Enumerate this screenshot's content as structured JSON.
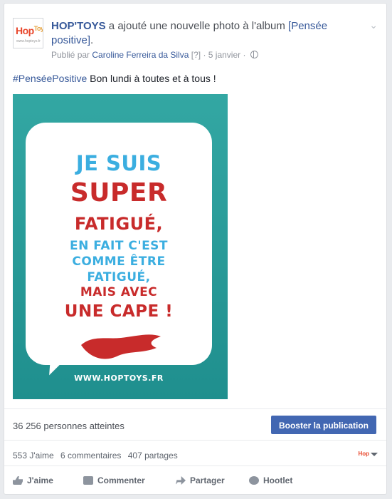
{
  "post": {
    "page_name": "HOP'TOYS",
    "action_text": " a ajouté une nouvelle photo à l'album ",
    "album_link": "[Pensée positive]",
    "after_link": ".",
    "published_by_prefix": "Publié par ",
    "author": "Caroline Ferreira da Silva",
    "qmark": "[?]",
    "date": " · 5 janvier · ",
    "hashtag": "#PenséePositive",
    "status_text": " Bon lundi à toutes et à tous !",
    "avatar_logo": "Hop",
    "avatar_logo_sup": "Toys",
    "avatar_url": "www.hoptoys.fr"
  },
  "photo": {
    "line1": "JE SUIS",
    "line2": "SUPER",
    "line3": "FATIGUÉ,",
    "line4a": "EN FAIT C'EST",
    "line4b": "COMME ÊTRE",
    "line4c": "FATIGUÉ,",
    "line5": "MAIS AVEC",
    "line6": "UNE CAPE !",
    "url": "WWW.HOPTOYS.FR",
    "colors": {
      "bg": "#2ba19e",
      "red": "#c82b2b",
      "blue": "#3baee0"
    }
  },
  "insights": {
    "reach": "36 256 personnes atteintes",
    "boost_label": "Booster la publication"
  },
  "stats": {
    "likes": "553 J'aime",
    "comments": "6 commentaires",
    "shares": "407 partages"
  },
  "actions": {
    "like": "J'aime",
    "comment": "Commenter",
    "share": "Partager",
    "hootlet": "Hootlet"
  },
  "icons": [
    "chevron-down-icon",
    "globe-icon",
    "like-icon",
    "comment-icon",
    "share-icon",
    "owl-icon",
    "caret-down-icon"
  ]
}
